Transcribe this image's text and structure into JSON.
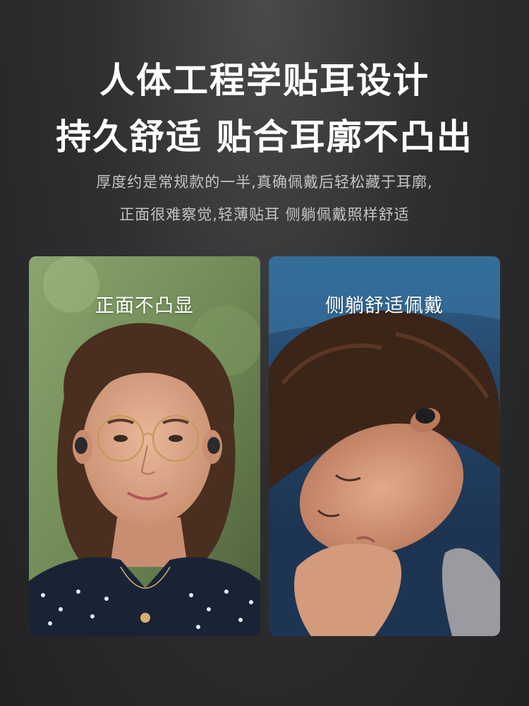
{
  "headline": {
    "line1": "人体工程学贴耳设计",
    "line2": "持久舒适 贴合耳廓不凸出"
  },
  "description": {
    "line1": "厚度约是常规款的一半,真确佩戴后轻松藏于耳廓,",
    "line2": "正面很难察觉,轻薄贴耳 侧躺佩戴照样舒适"
  },
  "photos": [
    {
      "label": "正面不凸显"
    },
    {
      "label": "侧躺舒适佩戴"
    }
  ]
}
